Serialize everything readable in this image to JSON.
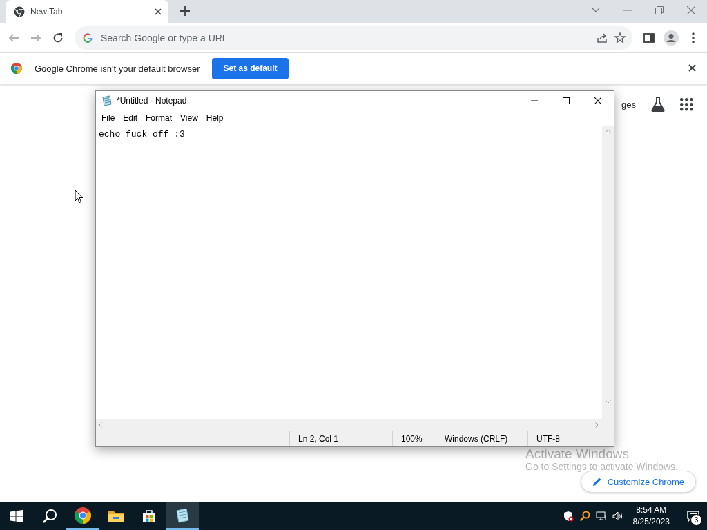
{
  "browser": {
    "tabs": [
      {
        "title": "New Tab",
        "selected": true
      }
    ],
    "omnibox": {
      "placeholder": "Search Google or type a URL"
    },
    "infobar": {
      "message": "Google Chrome isn't your default browser",
      "button": "Set as default"
    },
    "ntp": {
      "link_fragment": "ges",
      "customize_button": "Customize Chrome"
    }
  },
  "notepad": {
    "title": "*Untitled - Notepad",
    "menu": [
      "File",
      "Edit",
      "Format",
      "View",
      "Help"
    ],
    "text": "echo fuck off :3",
    "status": {
      "position": "Ln 2, Col 1",
      "zoom": "100%",
      "line_ending": "Windows (CRLF)",
      "encoding": "UTF-8"
    }
  },
  "activation": {
    "title": "Activate Windows",
    "message": "Go to Settings to activate Windows."
  },
  "taskbar": {
    "apps": [
      {
        "kind": "chrome",
        "running": true,
        "active": false
      },
      {
        "kind": "explorer",
        "running": false,
        "active": false
      },
      {
        "kind": "store",
        "running": false,
        "active": false
      },
      {
        "kind": "notepad",
        "running": true,
        "active": true
      }
    ],
    "time": "8:54 AM",
    "date": "8/25/2023",
    "notifications": "3"
  }
}
